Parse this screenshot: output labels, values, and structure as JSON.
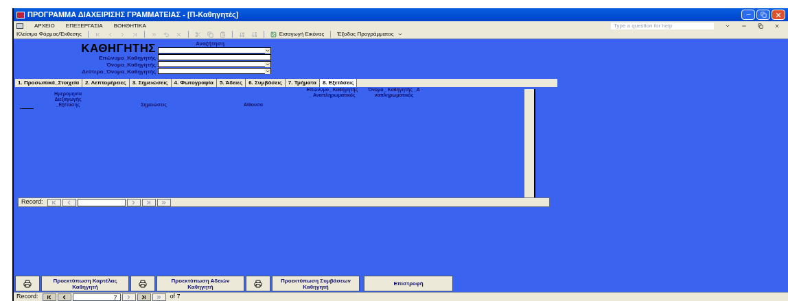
{
  "window": {
    "title": "ΠΡΟΓΡΑΜΜΑ ΔΙΑΧΕΙΡΙΣΗΣ ΓΡΑΜΜΑΤΕΙΑΣ - [Π-Καθηγητές]"
  },
  "menu": [
    "ΑΡΧΕΙΟ",
    "ΕΠΕΞΕΡΓΑΣΙΑ",
    "ΒΟΗΘΗΤΙΚΑ"
  ],
  "help": {
    "placeholder": "Type a question for help"
  },
  "toolbar": [
    {
      "kind": "close",
      "label": "Κλείσιμο Φόρμας/Έκθεσης"
    },
    {
      "kind": "image",
      "label": "Εισαγωγή Εικόνας"
    },
    {
      "kind": "exit",
      "label": "Έξοδος Προγράμματος"
    }
  ],
  "form": {
    "heading": "ΚΑΘΗΓΗΤΗΣ",
    "search_label": "Αναζήτηση",
    "fields": [
      {
        "dropdown": true
      },
      {
        "label": "Επώνυμο_Καθηγητής",
        "dropdown": false
      },
      {
        "label": "Όνομα_Καθηγητής",
        "dropdown": true
      },
      {
        "label": "Δεύτερο_Όνομα_Καθηγητής",
        "dropdown": true
      }
    ]
  },
  "tabs": [
    {
      "label": "1. Προσωπικά_Στοιχεία",
      "selected": false
    },
    {
      "label": "2. Λεπτομέρειες",
      "selected": false
    },
    {
      "label": "3. Σημειώσεις",
      "selected": false
    },
    {
      "label": "4. Φωτογραφία",
      "selected": false
    },
    {
      "label": "5. Άδειες",
      "selected": false
    },
    {
      "label": "6. Συμβάσεις",
      "selected": false
    },
    {
      "label": "7. Τμήματα",
      "selected": false
    },
    {
      "label": "8. Εξετάσεις",
      "selected": true
    }
  ],
  "table": {
    "columns": [
      "Ημερομηνία Διεξαγωγής _Εξέτασης",
      "Σημειώσεις",
      "Αίθουσα",
      "Επώνυμο_ Καθηγητής_ Αναπληρωματικός",
      "Όνομα_ Καθηγητής _Αναπληρωματικός"
    ]
  },
  "subform_nav": {
    "label": "Record:",
    "buttons": [
      {
        "disabled": true
      },
      {
        "disabled": true
      },
      {
        "disabled": true
      },
      {
        "disabled": true
      },
      {
        "disabled": true
      }
    ]
  },
  "buttons": [
    {
      "kind": "print"
    },
    {
      "kind": "text",
      "label": "Προεκτύπωση Καρτέλας Καθηγητή"
    },
    {
      "kind": "print"
    },
    {
      "kind": "text",
      "label": "Προεκτύπωση Αδειών Καθηγητή"
    },
    {
      "kind": "print"
    },
    {
      "kind": "text",
      "label": "Προεκτύπωση Συμβάσεων Καθηγητή"
    },
    {
      "kind": "wide",
      "label": "Επιστροφή"
    }
  ],
  "main_nav": {
    "label": "Record:",
    "value": "7",
    "total": "of 7",
    "buttons": [
      {
        "disabled": false
      },
      {
        "disabled": false
      },
      {
        "disabled": true
      },
      {
        "disabled": false
      },
      {
        "disabled": true
      }
    ]
  }
}
